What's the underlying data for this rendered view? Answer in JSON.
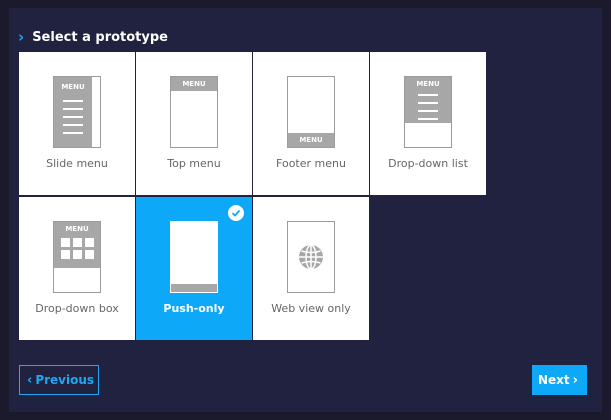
{
  "header": {
    "title": "Select a prototype"
  },
  "prototypes": [
    {
      "label": "Slide menu",
      "menu_text": "MENU"
    },
    {
      "label": "Top menu",
      "menu_text": "MENU"
    },
    {
      "label": "Footer menu",
      "menu_text": "MENU"
    },
    {
      "label": "Drop-down list",
      "menu_text": "MENU"
    },
    {
      "label": "Drop-down box",
      "menu_text": "MENU"
    },
    {
      "label": "Push-only",
      "selected": true
    },
    {
      "label": "Web view only",
      "icon": "globe-icon"
    }
  ],
  "footer": {
    "previous_label": "Previous",
    "next_label": "Next"
  },
  "colors": {
    "accent": "#0ea8f8",
    "panel": "#212140",
    "page": "#1a1a2c"
  }
}
